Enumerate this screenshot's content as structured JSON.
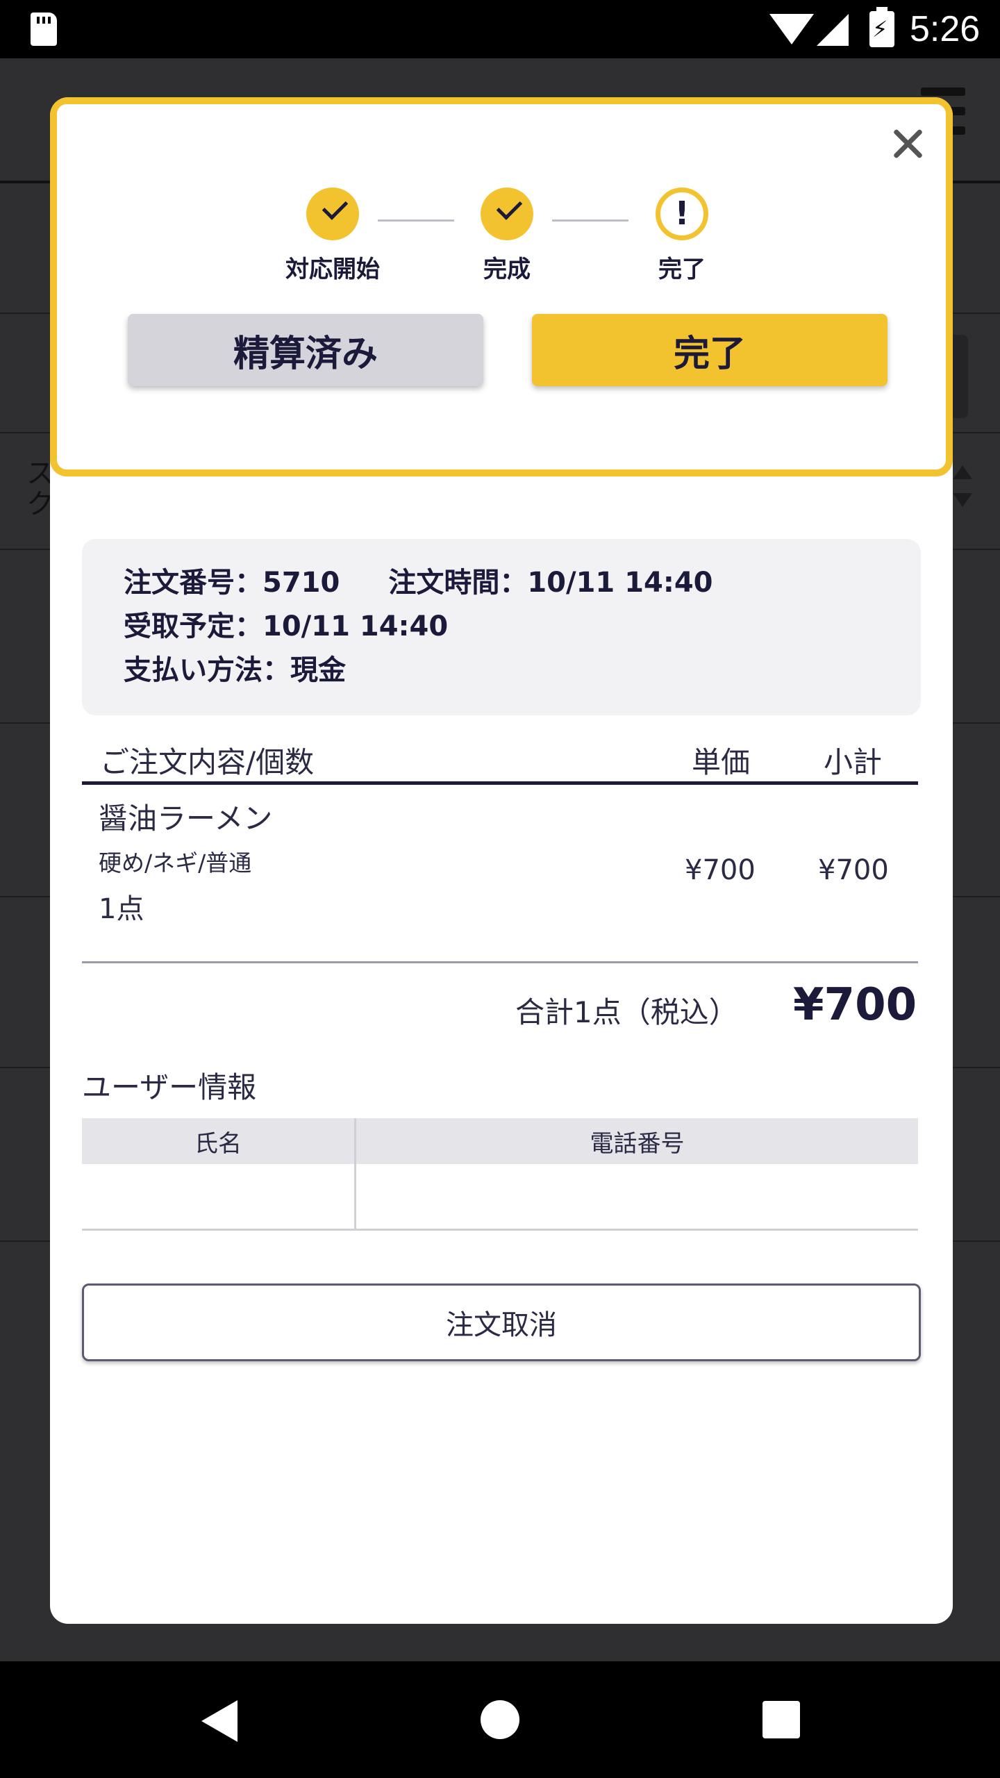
{
  "status_bar": {
    "time": "5:26"
  },
  "background": {
    "fragment_text": "ス\nク"
  },
  "progress": {
    "steps": [
      {
        "label": "対応開始",
        "state": "done"
      },
      {
        "label": "完成",
        "state": "done"
      },
      {
        "label": "完了",
        "state": "current"
      }
    ],
    "alert_glyph": "!"
  },
  "actions": {
    "settled_label": "精算済み",
    "complete_label": "完了"
  },
  "order_info": {
    "order_number_label": "注文番号：",
    "order_number": "5710",
    "order_time_label": "注文時間：",
    "order_time": "10/11 14:40",
    "pickup_label": "受取予定：",
    "pickup_time": "10/11 14:40",
    "payment_label": "支払い方法：",
    "payment_method": "現金"
  },
  "order_table": {
    "headers": {
      "content": "ご注文内容/個数",
      "unit_price": "単価",
      "subtotal": "小計"
    },
    "items": [
      {
        "name": "醤油ラーメン",
        "options": "硬め/ネギ/普通",
        "quantity": "1点",
        "unit_price": "¥700",
        "subtotal": "¥700"
      }
    ],
    "total_label": "合計1点（税込）",
    "total_value": "¥700"
  },
  "user_info": {
    "title": "ユーザー情報",
    "headers": {
      "name": "氏名",
      "phone": "電話番号"
    },
    "name": "",
    "phone": ""
  },
  "cancel_label": "注文取消",
  "colors": {
    "accent": "#f3c32f",
    "navy": "#1b1a3a",
    "grey_button": "#d4d4da",
    "info_bg": "#f2f2f4"
  }
}
